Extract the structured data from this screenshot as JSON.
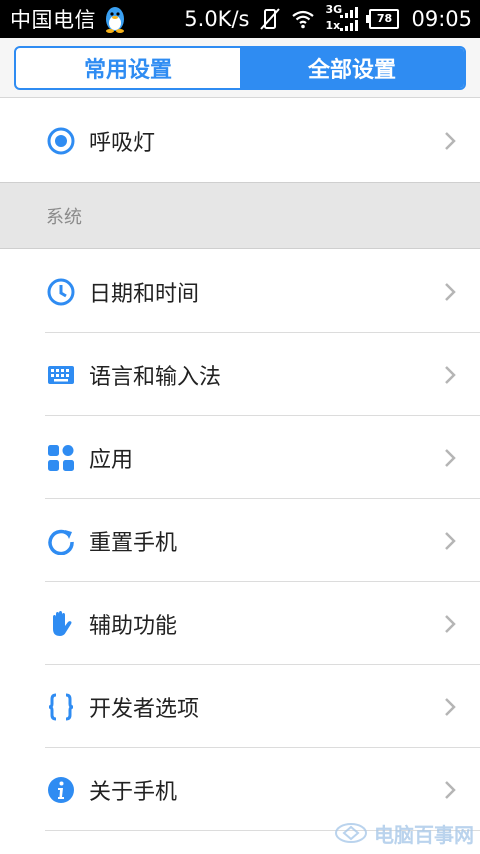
{
  "status_bar": {
    "carrier": "中国电信",
    "speed": "5.0K/s",
    "network": "3G",
    "network2": "1x",
    "battery": "78",
    "time": "09:05"
  },
  "header": {
    "tabs": [
      {
        "label": "常用设置",
        "active": false
      },
      {
        "label": "全部设置",
        "active": true
      }
    ]
  },
  "list": {
    "top_item": {
      "label": "呼吸灯",
      "icon": "breathing-light-icon"
    },
    "section_title": "系统",
    "items": [
      {
        "label": "日期和时间",
        "icon": "clock-icon"
      },
      {
        "label": "语言和输入法",
        "icon": "keyboard-icon"
      },
      {
        "label": "应用",
        "icon": "apps-icon"
      },
      {
        "label": "重置手机",
        "icon": "reset-icon"
      },
      {
        "label": "辅助功能",
        "icon": "hand-icon"
      },
      {
        "label": "开发者选项",
        "icon": "braces-icon"
      },
      {
        "label": "关于手机",
        "icon": "info-icon"
      }
    ]
  },
  "watermark": {
    "text": "电脑百事网"
  },
  "colors": {
    "accent": "#2f8cf2",
    "section_bg": "#e6e6e6"
  }
}
